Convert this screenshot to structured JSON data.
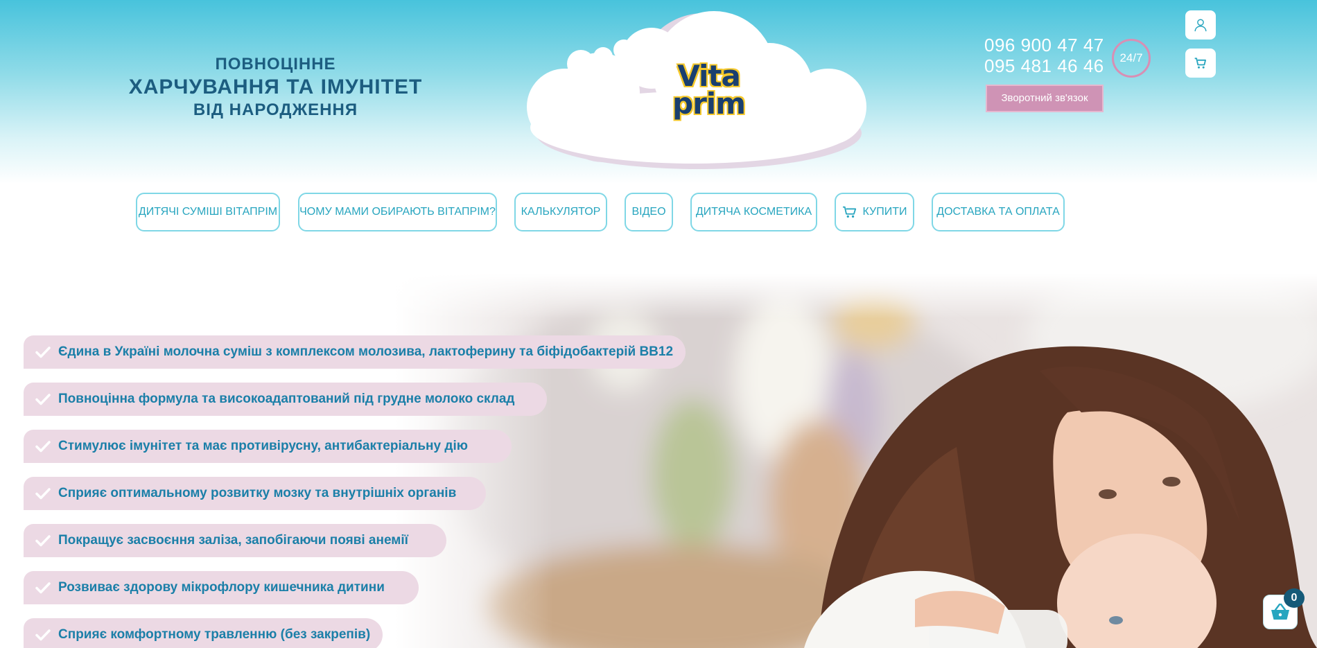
{
  "slogan": {
    "line1": "ПОВНОЦІННЕ",
    "line2": "ХАРЧУВАННЯ ТА ІМУНІТЕТ",
    "line3": "ВІД НАРОДЖЕННЯ"
  },
  "logo": {
    "word1": "Vita",
    "word2": "prim"
  },
  "contacts": {
    "phone1": "096 900 47 47",
    "phone2": "095 481 46 46",
    "badge": "24/7",
    "callback_label": "Зворотний зв'язок"
  },
  "header_icons": {
    "account": "user-icon",
    "cart": "cart-icon"
  },
  "nav": [
    {
      "label": "Дитячі суміші ВітаПрім"
    },
    {
      "label": "Чому мами обирають ВітаПрім?"
    },
    {
      "label": "Калькулятор"
    },
    {
      "label": "Відео"
    },
    {
      "label": "Дитяча косметика"
    },
    {
      "label": "Купити",
      "icon": "cart-icon"
    },
    {
      "label": "Доставка та оплата"
    }
  ],
  "features": [
    "Єдина в Україні молочна суміш з комплексом молозива, лактоферину та біфідобактерій BB12",
    "Повноцінна формула та високоадаптований під грудне молоко склад",
    "Стимулює імунітет та має противірусну, антибактеріальну дію",
    "Сприяє оптимальному розвитку мозку та внутрішніх органів",
    "Покращує засвоєння заліза, запобігаючи появі анемії",
    "Розвиває здорову мікрофлору кишечника дитини",
    "Сприяє комфортному травленню (без закрепів)"
  ],
  "cart_widget": {
    "count": "0",
    "icon": "basket-icon"
  },
  "colors": {
    "brand_blue": "#1c5d80",
    "accent_cyan": "#27a5bf",
    "pink": "#cf93b5",
    "feature_bg": "#ecd9e4",
    "feature_text": "#1b7fa8"
  }
}
